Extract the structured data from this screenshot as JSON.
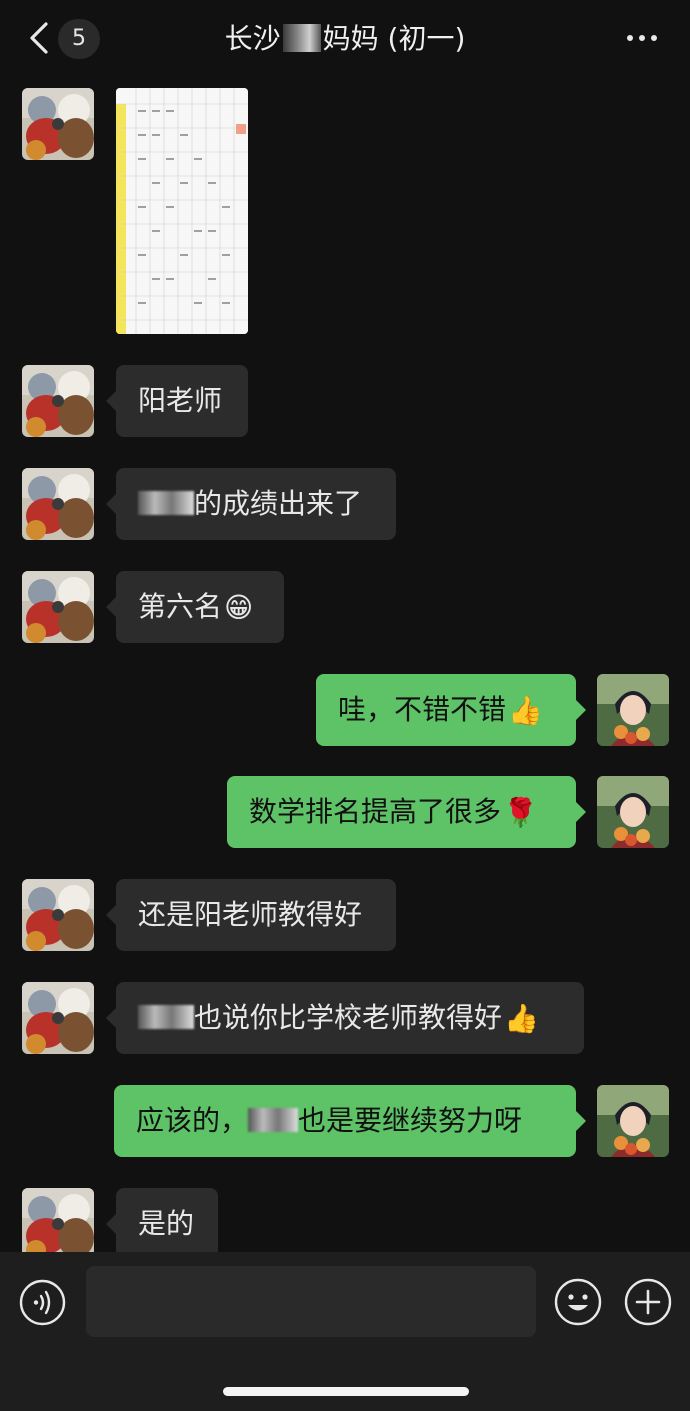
{
  "header": {
    "unread_count": "5",
    "title_prefix": "长沙",
    "title_suffix": "妈妈 (初一)"
  },
  "icons": {
    "back": "chevron-left-icon",
    "more": "ellipsis-icon",
    "voice": "voice-icon",
    "emoji": "smiley-icon",
    "plus": "plus-icon"
  },
  "messages": [
    {
      "side": "in",
      "type": "image",
      "text": ""
    },
    {
      "side": "in",
      "type": "text",
      "text": "阳老师"
    },
    {
      "side": "in",
      "type": "text",
      "text": "的成绩出来了"
    },
    {
      "side": "in",
      "type": "text",
      "text": "第六名",
      "emoji": "😁"
    },
    {
      "side": "out",
      "type": "text",
      "text": "哇，不错不错",
      "emoji": "👍"
    },
    {
      "side": "out",
      "type": "text",
      "text": "数学排名提高了很多",
      "emoji": "🌹"
    },
    {
      "side": "in",
      "type": "text",
      "text": "还是阳老师教得好"
    },
    {
      "side": "in",
      "type": "text",
      "text": "也说你比学校老师教得好",
      "emoji": "👍"
    },
    {
      "side": "out",
      "type": "text",
      "text_a": "应该的，",
      "text_b": "也是要继续努力呀"
    },
    {
      "side": "in",
      "type": "text",
      "text": "是的"
    }
  ],
  "colors": {
    "background": "#111111",
    "incoming_bubble": "#2c2c2c",
    "outgoing_bubble": "#5ec267",
    "input_bar": "#1e1e1e"
  }
}
